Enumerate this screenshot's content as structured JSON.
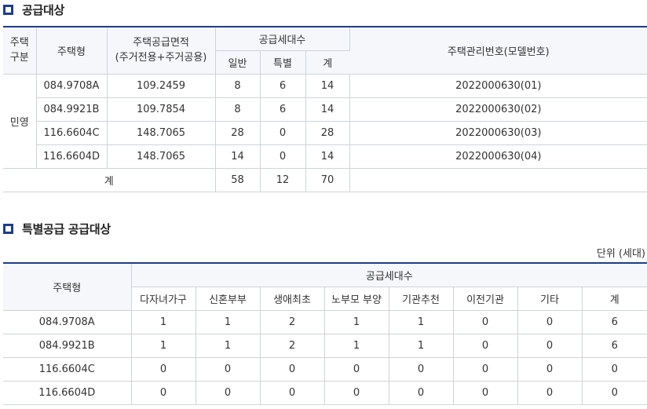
{
  "supply": {
    "heading": "공급대상",
    "headers": {
      "house_type_group": "주택\n구분",
      "house_type": "주택형",
      "area": "주택공급면적\n(주거전용+주거공용)",
      "units": "공급세대수",
      "units_general": "일반",
      "units_special": "특별",
      "units_total": "계",
      "model_no": "주택관리번호(모델번호)"
    },
    "group_label": "민영",
    "rows": [
      {
        "type": "084.9708A",
        "area": "109.2459",
        "general": "8",
        "special": "6",
        "total": "14",
        "model": "2022000630(01)"
      },
      {
        "type": "084.9921B",
        "area": "109.7854",
        "general": "8",
        "special": "6",
        "total": "14",
        "model": "2022000630(02)"
      },
      {
        "type": "116.6604C",
        "area": "148.7065",
        "general": "28",
        "special": "0",
        "total": "28",
        "model": "2022000630(03)"
      },
      {
        "type": "116.6604D",
        "area": "148.7065",
        "general": "14",
        "special": "0",
        "total": "14",
        "model": "2022000630(04)"
      }
    ],
    "total": {
      "label": "계",
      "general": "58",
      "special": "12",
      "total": "70"
    }
  },
  "special": {
    "heading": "특별공급 공급대상",
    "unit_label": "단위 (세대)",
    "headers": {
      "house_type": "주택형",
      "units": "공급세대수",
      "columns": [
        "다자녀가구",
        "신혼부부",
        "생애최초",
        "노부모 부양",
        "기관추천",
        "이전기관",
        "기타",
        "계"
      ]
    },
    "rows": [
      {
        "type": "084.9708A",
        "values": [
          "1",
          "1",
          "2",
          "1",
          "1",
          "0",
          "0",
          "6"
        ]
      },
      {
        "type": "084.9921B",
        "values": [
          "1",
          "1",
          "2",
          "1",
          "1",
          "0",
          "0",
          "6"
        ]
      },
      {
        "type": "116.6604C",
        "values": [
          "0",
          "0",
          "0",
          "0",
          "0",
          "0",
          "0",
          "0"
        ]
      },
      {
        "type": "116.6604D",
        "values": [
          "0",
          "0",
          "0",
          "0",
          "0",
          "0",
          "0",
          "0"
        ]
      }
    ]
  },
  "colors": {
    "accent": "#1f3c8c",
    "header_bg": "#f5f7fa",
    "border": "#cfd3da"
  }
}
